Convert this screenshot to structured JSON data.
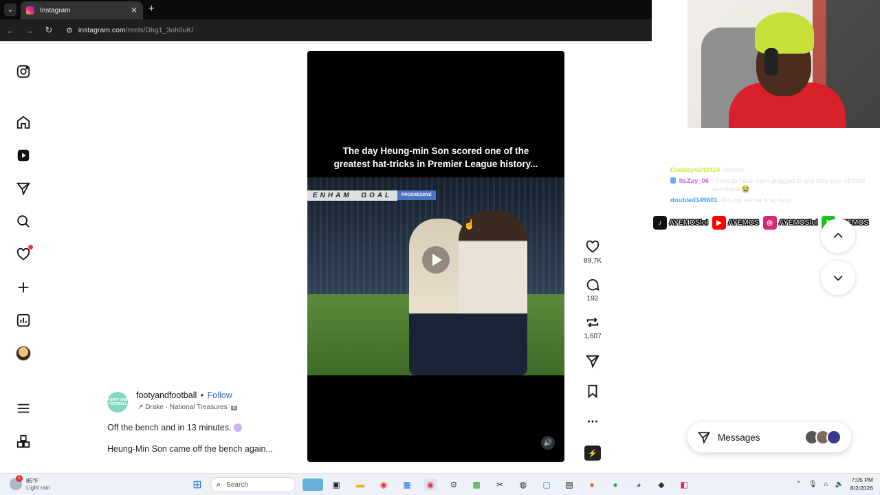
{
  "browser": {
    "tab_title": "Instagram",
    "close_glyph": "✕",
    "newtab_glyph": "+",
    "url_host": "instagram.com",
    "url_path": "/reels/Dbg1_3oh0uK/"
  },
  "sidebar": {
    "items": [
      {
        "name": "instagram-logo-icon"
      },
      {
        "name": "home-icon"
      },
      {
        "name": "reels-icon"
      },
      {
        "name": "messenger-icon"
      },
      {
        "name": "search-icon"
      },
      {
        "name": "notifications-heart-icon"
      },
      {
        "name": "create-plus-icon"
      },
      {
        "name": "dashboard-icon"
      },
      {
        "name": "profile-avatar"
      },
      {
        "name": "more-menu-icon"
      },
      {
        "name": "also-from-meta-icon"
      }
    ]
  },
  "reel": {
    "caption_line1": "The day Heung-min Son scored one of the",
    "caption_line2": "greatest hat-tricks in Premier League history...",
    "banner_prefix": "ENHAM",
    "banner_goal": "GOAL",
    "banner_tag": "PROGRESSIVE"
  },
  "actions": {
    "likes": "89.7K",
    "comments": "192",
    "reposts": "1,607"
  },
  "post": {
    "avatar_text": "FOOTY AND FOOTBALL",
    "username": "footyandfootball",
    "separator": "•",
    "follow_label": "Follow",
    "audio": "Drake · National Treasures",
    "audio_badge": "E",
    "line1": "Off the bench and in 13 minutes.",
    "line2": "Heung-Min Son came off the bench again..."
  },
  "chat": {
    "messages": [
      {
        "user": "Dondayo242424",
        "text": "Hmmm",
        "color": "#c3f03b"
      },
      {
        "user": "ItsZay_06",
        "text": "I have to have them plugged in and they turn off here and there 😭",
        "color": "#d45cff"
      },
      {
        "user": "doubled149601",
        "text": "Bro my panda is so long",
        "color": "#3fa3ff"
      }
    ]
  },
  "socials": [
    {
      "icon": "♪",
      "name": "AYEMOSlol",
      "bg": "#111111"
    },
    {
      "icon": "▶",
      "name": "AYEMOS",
      "bg": "#ff0000"
    },
    {
      "icon": "◎",
      "name": "AYEMOSlol",
      "bg": "#d62976"
    },
    {
      "icon": "K",
      "name": "AYEMOS",
      "bg": "#20c020"
    }
  ],
  "messages": {
    "label": "Messages"
  },
  "taskbar": {
    "temp": "85°F",
    "weather": "Light rain",
    "weather_badge": "1",
    "search": "Search",
    "time": "7:05 PM",
    "date": "8/2/2026"
  }
}
